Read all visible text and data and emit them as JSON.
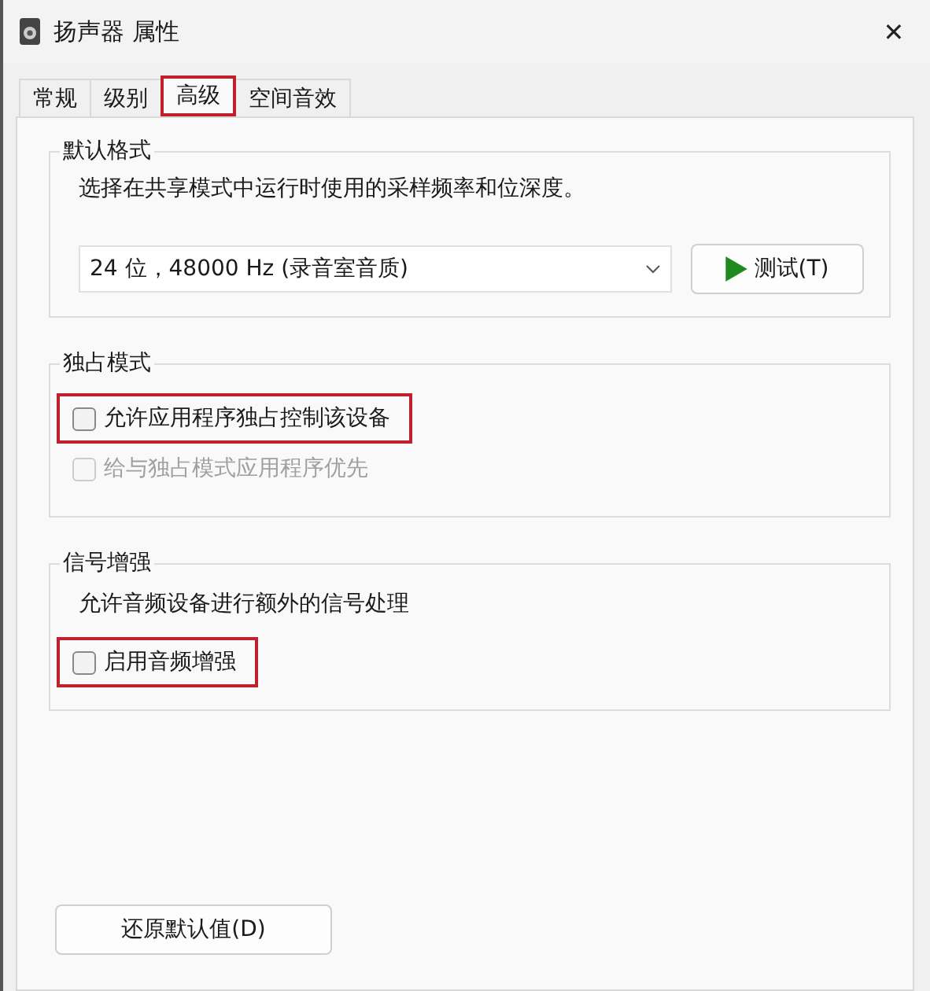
{
  "window": {
    "title": "扬声器 属性",
    "close": "✕"
  },
  "tabs": [
    {
      "label": "常规",
      "selected": false,
      "highlighted": false
    },
    {
      "label": "级别",
      "selected": false,
      "highlighted": false
    },
    {
      "label": "高级",
      "selected": true,
      "highlighted": true
    },
    {
      "label": "空间音效",
      "selected": false,
      "highlighted": false
    }
  ],
  "default_format": {
    "title": "默认格式",
    "description": "选择在共享模式中运行时使用的采样频率和位深度。",
    "format": "24 位，48000 Hz (录音室音质)",
    "test_button": "测试(T)"
  },
  "exclusive_mode": {
    "title": "独占模式",
    "checkboxes": [
      {
        "label": "允许应用程序独占控制该设备",
        "checked": false,
        "disabled": false,
        "highlighted": true
      },
      {
        "label": "给与独占模式应用程序优先",
        "checked": false,
        "disabled": true,
        "highlighted": false
      }
    ]
  },
  "signal_enhancement": {
    "title": "信号增强",
    "description": "允许音频设备进行额外的信号处理",
    "checkboxes": [
      {
        "label": "启用音频增强",
        "checked": false,
        "disabled": false,
        "highlighted": true
      }
    ]
  },
  "restore_button": "还原默认值(D)"
}
